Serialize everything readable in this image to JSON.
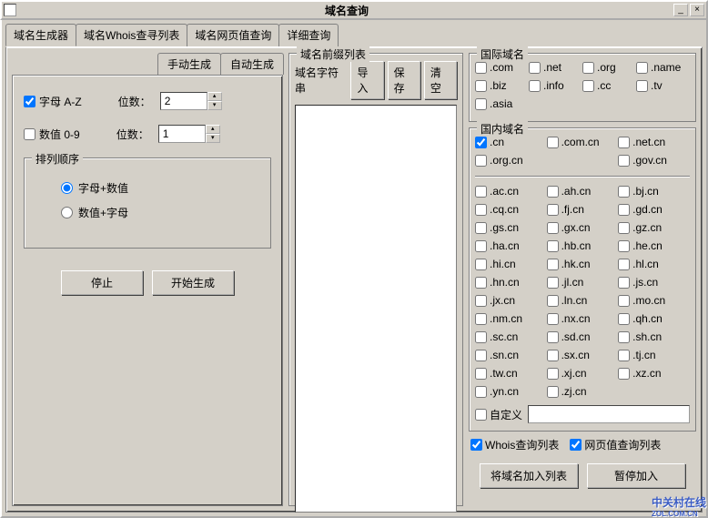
{
  "titlebar": {
    "title": "域名查询",
    "minimize": "_",
    "close": "×"
  },
  "tabs": [
    "域名生成器",
    "域名Whois查寻列表",
    "域名网页值查询",
    "详细查询"
  ],
  "active_tab": 0,
  "sub_tabs": [
    "手动生成",
    "自动生成"
  ],
  "active_sub": 0,
  "form": {
    "letters_label": "字母 A-Z",
    "letters_checked": true,
    "letters_digits_label": "位数：",
    "letters_digits_value": "2",
    "numbers_label": "数值 0-9",
    "numbers_checked": false,
    "numbers_digits_label": "位数：",
    "numbers_digits_value": "1",
    "order_legend": "排列顺序",
    "order_opts": [
      "字母+数值",
      "数值+字母"
    ],
    "order_sel": 0,
    "stop": "停止",
    "start": "开始生成"
  },
  "prefix": {
    "legend": "域名前缀列表",
    "string_label": "域名字符串",
    "import": "导入",
    "save": "保存",
    "clear": "清空"
  },
  "intl": {
    "legend": "国际域名",
    "items": [
      {
        "label": ".com",
        "checked": false
      },
      {
        "label": ".net",
        "checked": false
      },
      {
        "label": ".org",
        "checked": false
      },
      {
        "label": ".name",
        "checked": false
      },
      {
        "label": ".biz",
        "checked": false
      },
      {
        "label": ".info",
        "checked": false
      },
      {
        "label": ".cc",
        "checked": false
      },
      {
        "label": ".tv",
        "checked": false
      },
      {
        "label": ".asia",
        "checked": false
      }
    ]
  },
  "domestic": {
    "legend": "国内域名",
    "top": [
      {
        "label": ".cn",
        "checked": true
      },
      {
        "label": ".com.cn",
        "checked": false
      },
      {
        "label": ".net.cn",
        "checked": false
      },
      {
        "label": ".org.cn",
        "checked": false
      },
      {
        "label": "",
        "checked": false,
        "empty": true
      },
      {
        "label": ".gov.cn",
        "checked": false
      }
    ],
    "rest": [
      ".ac.cn",
      ".ah.cn",
      ".bj.cn",
      ".cq.cn",
      ".fj.cn",
      ".gd.cn",
      ".gs.cn",
      ".gx.cn",
      ".gz.cn",
      ".ha.cn",
      ".hb.cn",
      ".he.cn",
      ".hi.cn",
      ".hk.cn",
      ".hl.cn",
      ".hn.cn",
      ".jl.cn",
      ".js.cn",
      ".jx.cn",
      ".ln.cn",
      ".mo.cn",
      ".nm.cn",
      ".nx.cn",
      ".qh.cn",
      ".sc.cn",
      ".sd.cn",
      ".sh.cn",
      ".sn.cn",
      ".sx.cn",
      ".tj.cn",
      ".tw.cn",
      ".xj.cn",
      ".xz.cn",
      ".yn.cn",
      ".zj.cn"
    ],
    "custom": "自定义"
  },
  "bottom_checks": [
    {
      "label": "Whois查询列表",
      "checked": true
    },
    {
      "label": "网页值查询列表",
      "checked": true
    }
  ],
  "bottom_btns": [
    "将域名加入列表",
    "暂停加入"
  ],
  "watermark": {
    "line1": "中关村在线",
    "line2": "ZOL.COM.CN"
  }
}
